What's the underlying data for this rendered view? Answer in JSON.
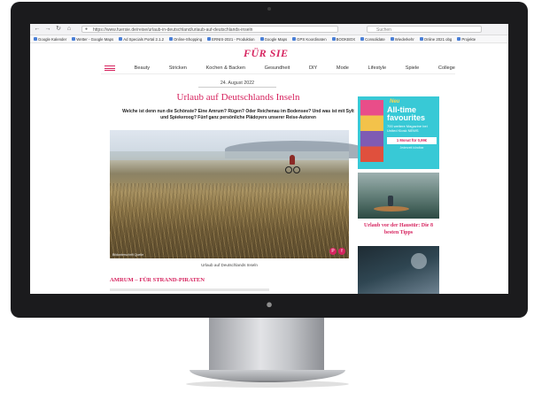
{
  "browser": {
    "nav_back": "←",
    "nav_forward": "→",
    "nav_reload": "↻",
    "nav_home": "⌂",
    "url": "https://www.fuersie.de/reise/urlaub-in-deutschland/urlaub-auf-deutschlands-inseln",
    "search_placeholder": "Suchen",
    "bookmarks": [
      "Google Kalender",
      "Wetter - Google Maps",
      "Ad Specials Portal 2.1.2",
      "Online-Shopping",
      "ERNIS-2021 - Produktion",
      "Google Maps",
      "GPS Koordinaten",
      "BOOKBOX",
      "Consolidate",
      "Wiederkehr",
      "Online 2021 obg",
      "Projekte"
    ]
  },
  "site": {
    "logo": "FÜR SIE",
    "categories": [
      "Beauty",
      "Stricken",
      "Kochen & Backen",
      "Gesundheit",
      "DIY",
      "Mode",
      "Lifestyle",
      "Spiele",
      "College"
    ]
  },
  "article": {
    "date": "24. August 2022",
    "title": "Urlaub auf Deutschlands Inseln",
    "teaser": "Welche ist denn nun die Schönste? Eine Amrum? Rügen? Oder Reichenau im Bodensee? Und was ist mit Sylt und Spiekeroog? Fünf ganz persönliche Plädoyers unserer Reise-Autoren",
    "photo_credit": "Bildunterschrift Quelle",
    "caption": "Urlaub auf Deutschlands Inseln",
    "section_heading": "AMRUM – FÜR STRAND-PIRATEN"
  },
  "sidebar": {
    "ad": {
      "badge": "Neu",
      "title": "All-time favourites",
      "subtitle": "700 weitere Magazine bei United Kiosk NEWS",
      "button": "1 Monat für 0,99€",
      "fine_print": "Jederzeit kündbar"
    },
    "teaser_label": "Urlaub vor der Haustür: Die 8 besten Tipps"
  },
  "colors": {
    "brand": "#d6245f",
    "ad_bg": "#38c9d6"
  }
}
